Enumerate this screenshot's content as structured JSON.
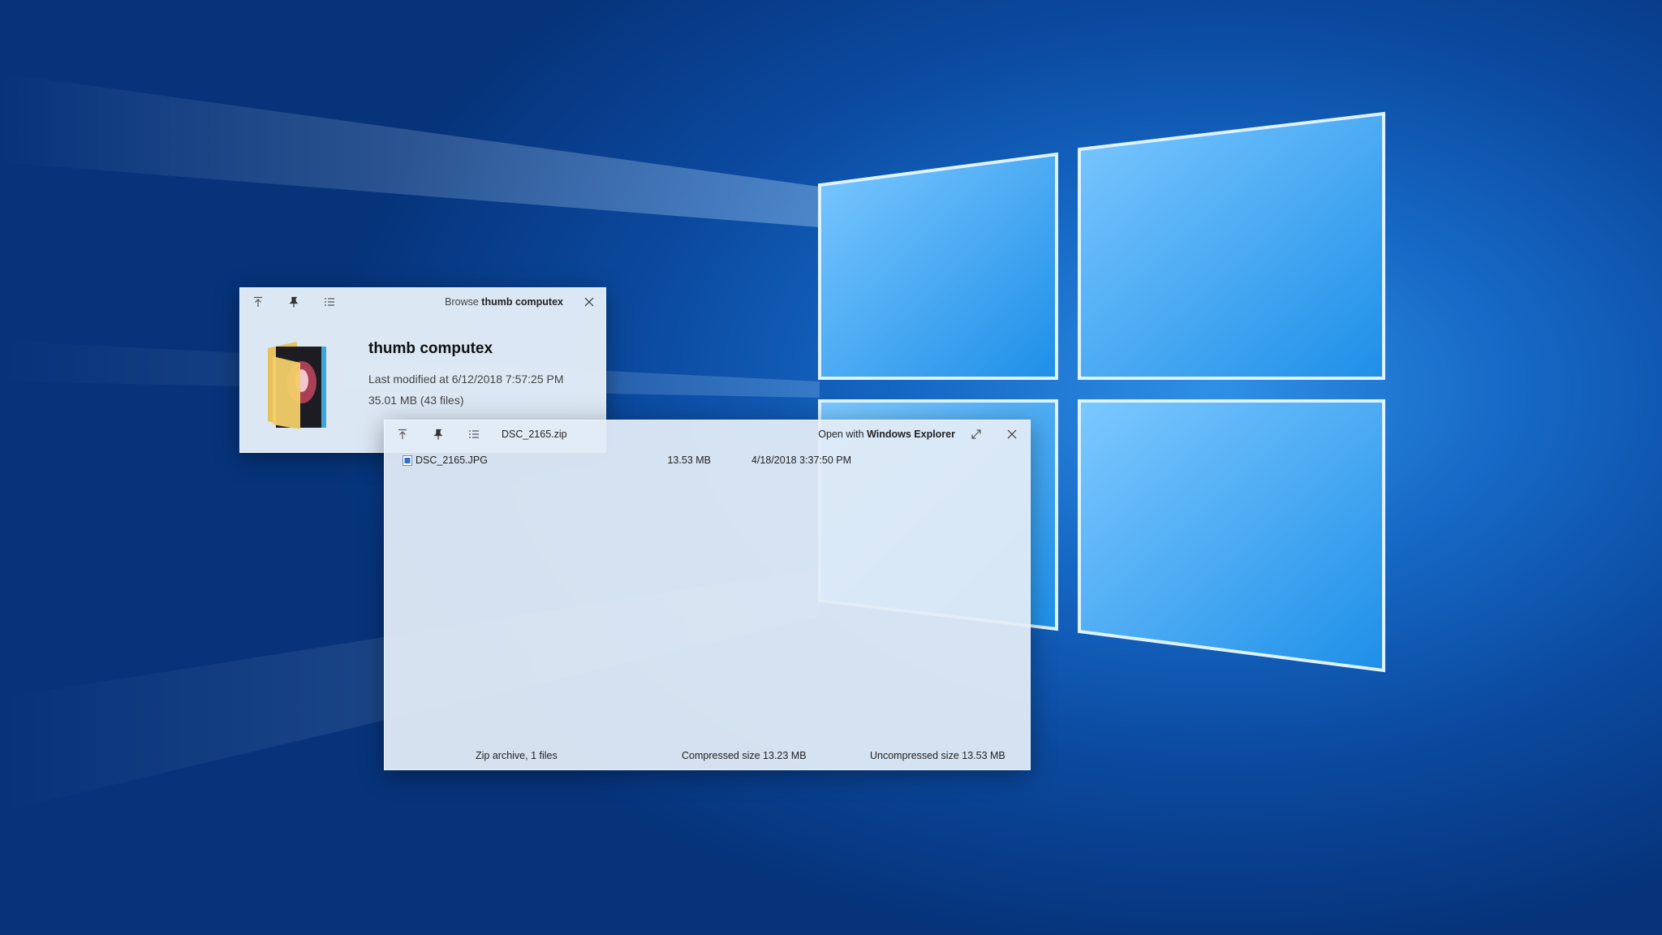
{
  "folder_window": {
    "browse_prefix": "Browse",
    "browse_target": "thumb computex",
    "folder_name": "thumb computex",
    "last_modified": "Last modified at 6/12/2018 7:57:25 PM",
    "size_info": "35.01 MB (43 files)",
    "icons": [
      "back-to-top-icon",
      "pin-icon",
      "list-view-icon",
      "close-icon"
    ]
  },
  "zip_window": {
    "file_name": "DSC_2165.zip",
    "open_with_prefix": "Open with",
    "open_with_app": "Windows Explorer",
    "icons": [
      "back-to-top-icon",
      "pin-icon",
      "list-view-icon",
      "expand-icon",
      "close-icon"
    ],
    "files": [
      {
        "name": "DSC_2165.JPG",
        "size": "13.53 MB",
        "modified": "4/18/2018 3:37:50 PM"
      }
    ],
    "status": {
      "archive_info": "Zip archive, 1 files",
      "compressed": "Compressed size 13.23 MB",
      "uncompressed": "Uncompressed size 13.53 MB"
    }
  },
  "colors": {
    "desktop_blue": "#0b4aa0",
    "window_bg": "#e4eef8"
  }
}
